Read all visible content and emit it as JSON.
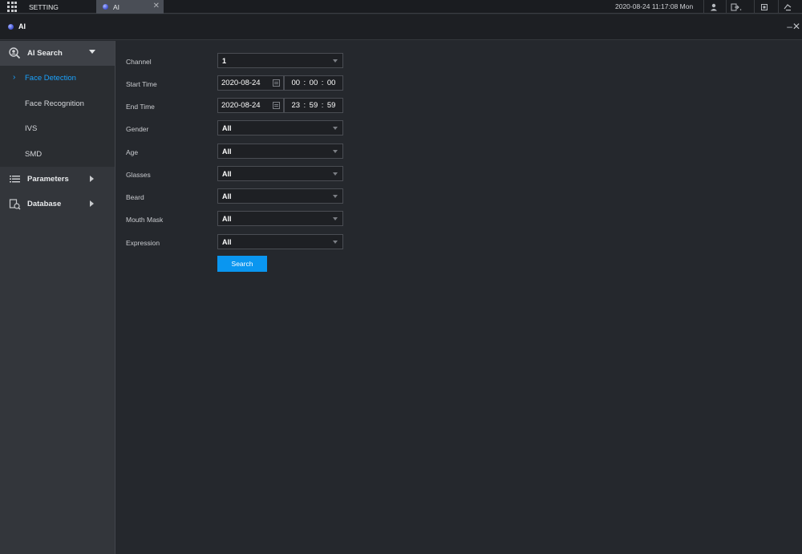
{
  "topbar": {
    "setting_label": "SETTING",
    "tab_ai_label": "AI",
    "datetime": "2020-08-24 11:17:08 Mon"
  },
  "window": {
    "title": "AI"
  },
  "sidebar": {
    "groups": [
      {
        "label": "AI Search",
        "icon": "search-face-icon"
      },
      {
        "label": "Parameters",
        "icon": "list-icon"
      },
      {
        "label": "Database",
        "icon": "database-icon"
      }
    ],
    "sub_items": [
      "Face Detection",
      "Face Recognition",
      "IVS",
      "SMD"
    ],
    "selected": "Face Detection"
  },
  "form": {
    "channel": {
      "label": "Channel",
      "value": "1"
    },
    "start_time": {
      "label": "Start Time",
      "date": "2020-08-24",
      "h": "00",
      "m": "00",
      "s": "00"
    },
    "end_time": {
      "label": "End Time",
      "date": "2020-08-24",
      "h": "23",
      "m": "59",
      "s": "59"
    },
    "gender": {
      "label": "Gender",
      "value": "All"
    },
    "age": {
      "label": "Age",
      "value": "All"
    },
    "glasses": {
      "label": "Glasses",
      "value": "All"
    },
    "beard": {
      "label": "Beard",
      "value": "All"
    },
    "mouth_mask": {
      "label": "Mouth Mask",
      "value": "All"
    },
    "expression": {
      "label": "Expression",
      "value": "All"
    },
    "search_label": "Search"
  },
  "colors": {
    "accent": "#1aa3ff",
    "button": "#0a96f0",
    "background": "#25282d"
  }
}
